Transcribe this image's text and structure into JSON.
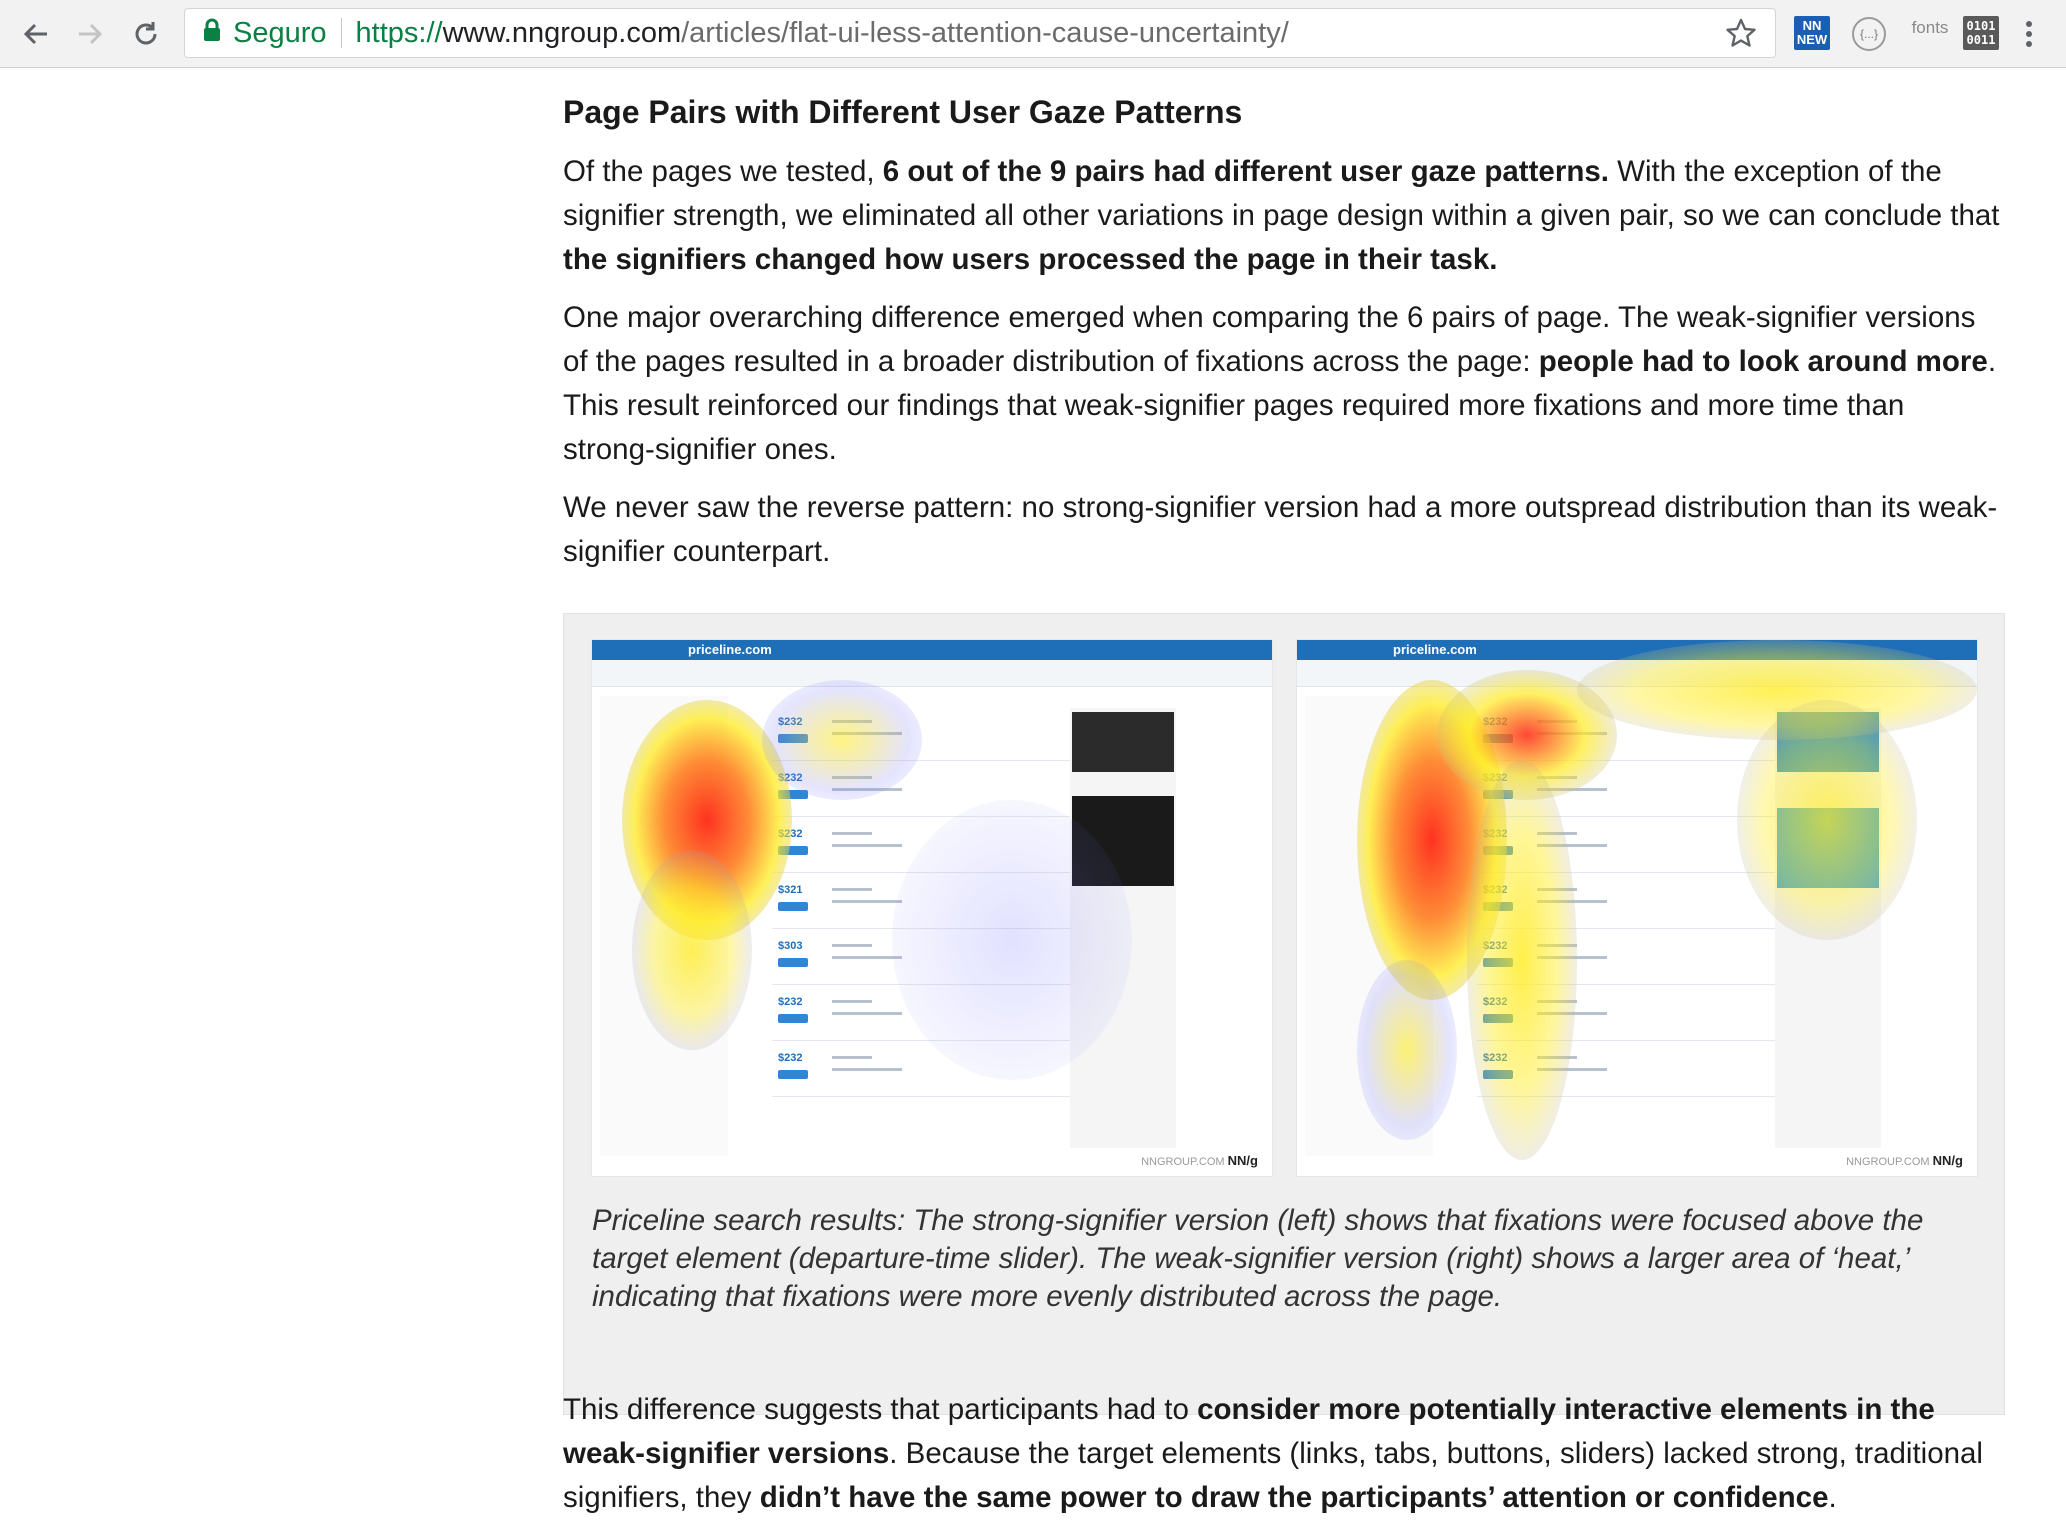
{
  "browser": {
    "secure_label": "Seguro",
    "url_scheme": "https://",
    "url_host": "www.nngroup.com",
    "url_path": "/articles/flat-ui-less-attention-cause-uncertainty/",
    "icons": [
      "back-arrow-icon",
      "forward-arrow-icon",
      "reload-icon",
      "lock-icon",
      "bookmark-star-icon",
      "menu-dots-icon"
    ],
    "extensions": {
      "new_top": "NN",
      "new_bottom": "NEW",
      "json_label": "{...}",
      "fonts_label": "fonts",
      "binary_top": "0101",
      "binary_bottom": "0011"
    }
  },
  "article": {
    "heading": "Page Pairs with Different User Gaze Patterns",
    "p1": {
      "t1": "Of the pages we tested, ",
      "b1": "6 out of the 9 pairs had different user gaze patterns.",
      "t2": " With the exception of the signifier strength, we eliminated all other variations in page design within a given pair, so we can conclude that ",
      "b2": "the signifiers changed how users processed the page in their task."
    },
    "p2": {
      "t1": "One major overarching difference emerged when comparing the 6 pairs of page. The weak-signifier versions of the pages resulted in a broader distribution of fixations across the page: ",
      "b1": "people had to look around more",
      "t2": ". This result reinforced our findings that weak-signifier pages required more fixations and more time than strong-signifier ones."
    },
    "p3": "We never saw the reverse pattern: no strong-signifier version had a more outspread distribution than its weak-signifier counterpart.",
    "figure": {
      "left_logo": "priceline.com",
      "right_logo": "priceline.com",
      "watermark_site": "NNGROUP.COM",
      "watermark_brand": "NN/g",
      "caption": "Priceline search results: The strong-signifier version (left) shows that fixations were focused above the target element (departure-time slider). The weak-signifier version (right) shows a larger area of ‘heat,’ indicating that fixations were more evenly distributed across the page."
    },
    "p4": {
      "t1": "This difference suggests that participants had to ",
      "b1": "consider more potentially interactive elements in the weak-signifier versions",
      "t2": ". Because the target elements (links, tabs, buttons, sliders) lacked strong, traditional signifiers, they ",
      "b2": "didn’t have the same power to draw the participants’ attention or confidence",
      "t3": "."
    }
  }
}
